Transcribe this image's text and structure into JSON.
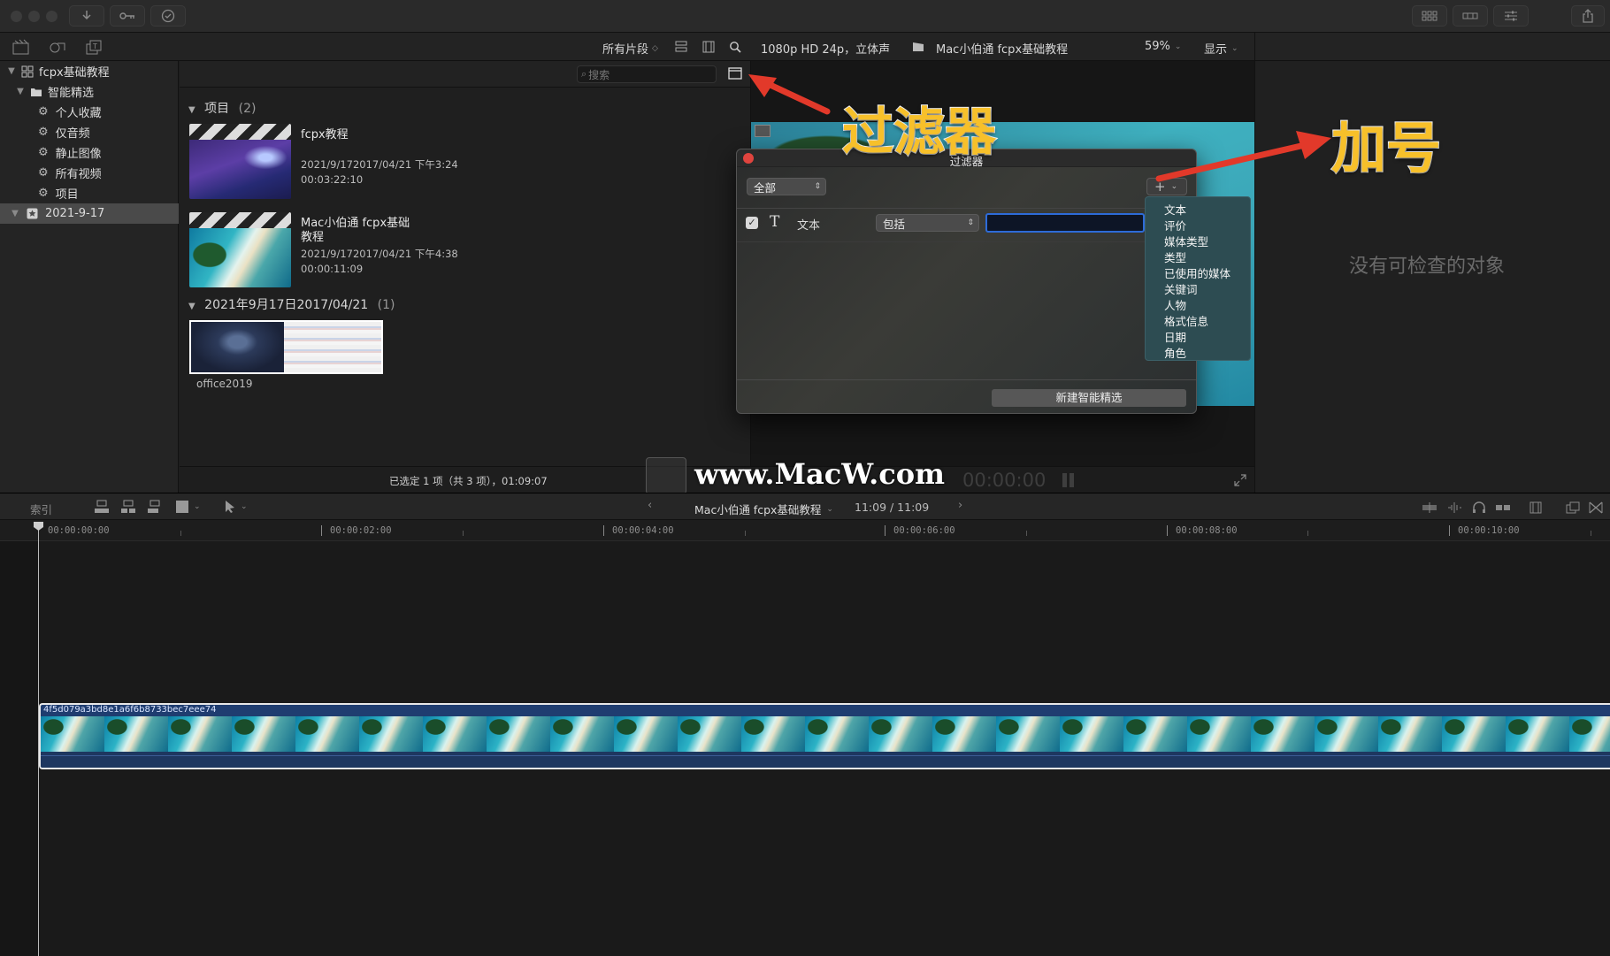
{
  "window": {
    "title_buttons": [
      "download-icon",
      "key-icon",
      "checkmark-circle-icon"
    ],
    "right_buttons": [
      "grid-view-icon",
      "layout-icon",
      "sliders-icon",
      "share-icon"
    ]
  },
  "library_bar": {
    "filter_label": "所有片段",
    "viewer_format": "1080p HD 24p，立体声",
    "viewer_project": "Mac小伯通 fcpx基础教程",
    "zoom": "59%",
    "display": "显示"
  },
  "sidebar": {
    "library_name": "fcpx基础教程",
    "folder_name": "智能精选",
    "items": [
      {
        "label": "个人收藏"
      },
      {
        "label": "仅音频"
      },
      {
        "label": "静止图像"
      },
      {
        "label": "所有视频"
      },
      {
        "label": "项目"
      }
    ],
    "event": "2021-9-17"
  },
  "browser": {
    "search_placeholder": "搜索",
    "section1": {
      "title": "项目",
      "count": "(2)"
    },
    "clips": [
      {
        "title": "fcpx教程",
        "date": "2021/9/172017/04/21 下午3:24",
        "duration": "00:03:22:10"
      },
      {
        "title_line1": "Mac小伯通 fcpx基础",
        "title_line2": "教程",
        "date": "2021/9/172017/04/21 下午4:38",
        "duration": "00:00:11:09"
      }
    ],
    "section2": {
      "title": "2021年9月17日2017/04/21",
      "count": "(1)"
    },
    "event_clip": {
      "name": "office2019"
    },
    "status": "已选定 1 项（共 3 项），01:09:07"
  },
  "viewer": {
    "timecode": "00:00:00"
  },
  "inspector": {
    "empty_text": "没有可检查的对象"
  },
  "filter_dialog": {
    "title": "过滤器",
    "scope": "全部",
    "rule_type": "文本",
    "rule_operator": "包括",
    "new_smart_collection": "新建智能精选",
    "add_menu": [
      "文本",
      "评价",
      "媒体类型",
      "类型",
      "已使用的媒体",
      "关键词",
      "人物",
      "格式信息",
      "日期",
      "角色"
    ]
  },
  "annotations": {
    "filter": "过滤器",
    "plus": "加号"
  },
  "watermark": "www.MacW.com",
  "timeline": {
    "index_label": "索引",
    "project_name": "Mac小伯通 fcpx基础教程",
    "duration": "11:09 / 11:09",
    "ruler": [
      "00:00:00:00",
      "00:00:02:00",
      "00:00:04:00",
      "00:00:06:00",
      "00:00:08:00",
      "00:00:10:00"
    ],
    "clip_name": "4f5d079a3bd8e1a6f6b8733bec7eee74"
  }
}
